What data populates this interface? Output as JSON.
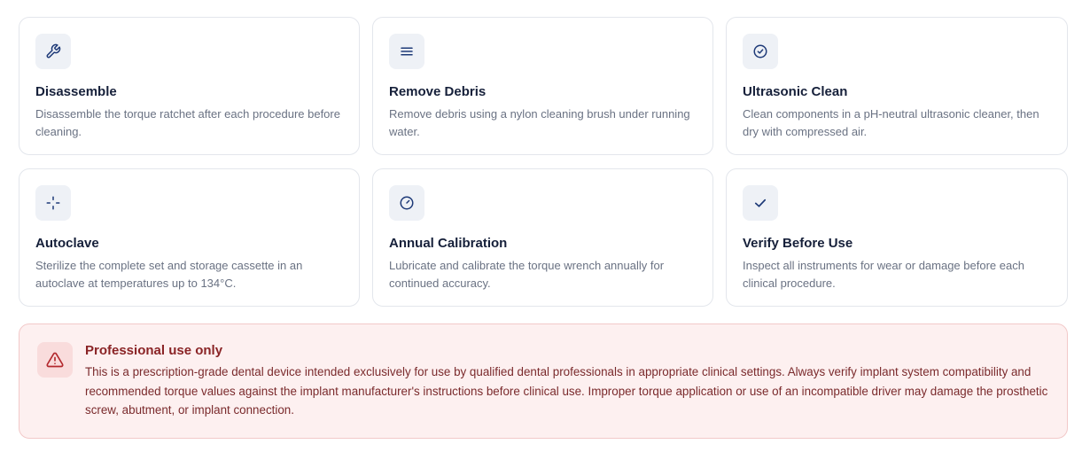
{
  "steps": [
    {
      "icon": "wrench-icon",
      "title": "Disassemble",
      "text": "Disassemble the torque ratchet after each procedure before cleaning."
    },
    {
      "icon": "lines-icon",
      "title": "Remove Debris",
      "text": "Remove debris using a nylon cleaning brush under running water."
    },
    {
      "icon": "check-circle-icon",
      "title": "Ultrasonic Clean",
      "text": "Clean components in a pH-neutral ultrasonic cleaner, then dry with compressed air."
    },
    {
      "icon": "crosshair-icon",
      "title": "Autoclave",
      "text": "Sterilize the complete set and storage cassette in an autoclave at temperatures up to 134°C."
    },
    {
      "icon": "gauge-icon",
      "title": "Annual Calibration",
      "text": "Lubricate and calibrate the torque wrench annually for continued accuracy."
    },
    {
      "icon": "check-icon",
      "title": "Verify Before Use",
      "text": "Inspect all instruments for wear or damage before each clinical procedure."
    }
  ],
  "alert": {
    "icon": "warning-triangle-icon",
    "title": "Professional use only",
    "text": "This is a prescription-grade dental device intended exclusively for use by qualified dental professionals in appropriate clinical settings. Always verify implant system compatibility and recommended torque values against the implant manufacturer's instructions before clinical use. Improper torque application or use of an incompatible driver may damage the prosthetic screw, abutment, or implant connection."
  },
  "colors": {
    "icon_navy": "#1e3a78",
    "icon_bg": "#eef1f6",
    "alert_bg": "#fdf0f0",
    "alert_border": "#f2c9c9",
    "alert_accent": "#b3282d"
  }
}
